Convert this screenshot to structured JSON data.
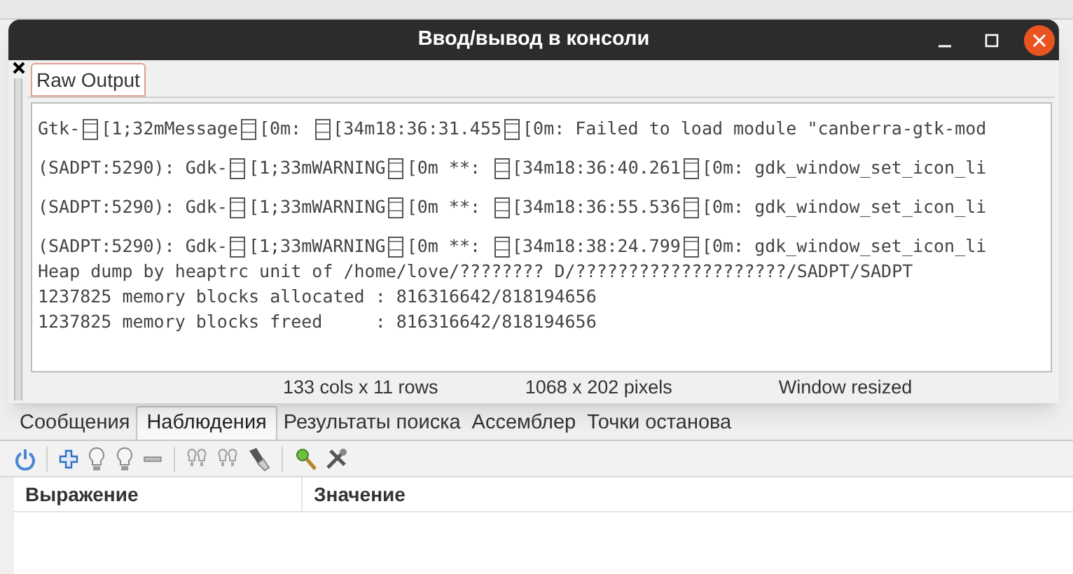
{
  "window": {
    "title": "Ввод/вывод в консоли"
  },
  "tabs": [
    {
      "label": "Raw Output",
      "selected": true
    }
  ],
  "console_lines": [
    {
      "segments": [
        "Gtk-",
        "[1;32mMessage",
        "[0m: ",
        "[34m18:36:31.455",
        "[0m: Failed to load module \"canberra-gtk-mod"
      ],
      "blank_before": false
    },
    {
      "segments": [
        "(SADPT:5290): Gdk-",
        "[1;33mWARNING",
        "[0m **: ",
        "[34m18:36:40.261",
        "[0m: gdk_window_set_icon_li"
      ],
      "blank_before": true
    },
    {
      "segments": [
        "(SADPT:5290): Gdk-",
        "[1;33mWARNING",
        "[0m **: ",
        "[34m18:36:55.536",
        "[0m: gdk_window_set_icon_li"
      ],
      "blank_before": true
    },
    {
      "segments": [
        "(SADPT:5290): Gdk-",
        "[1;33mWARNING",
        "[0m **: ",
        "[34m18:38:24.799",
        "[0m: gdk_window_set_icon_li"
      ],
      "blank_before": true
    },
    {
      "segments": [
        "Heap dump by heaptrc unit of /home/love/???????? D/????????????????????/SADPT/SADPT"
      ],
      "blank_before": false
    },
    {
      "segments": [
        "1237825 memory blocks allocated : 816316642/818194656"
      ],
      "blank_before": false
    },
    {
      "segments": [
        "1237825 memory blocks freed     : 816316642/818194656"
      ],
      "blank_before": false
    }
  ],
  "status_bar": [
    "133 cols x 11 rows",
    "1068 x 202 pixels",
    "Window resized"
  ],
  "bottom_tabs": [
    {
      "label": "Сообщения",
      "selected": false
    },
    {
      "label": "Наблюдения",
      "selected": true
    },
    {
      "label": "Результаты поиска",
      "selected": false
    },
    {
      "label": "Ассемблер",
      "selected": false
    },
    {
      "label": "Точки останова",
      "selected": false
    }
  ],
  "table": {
    "columns": [
      "Выражение",
      "Значение"
    ]
  }
}
